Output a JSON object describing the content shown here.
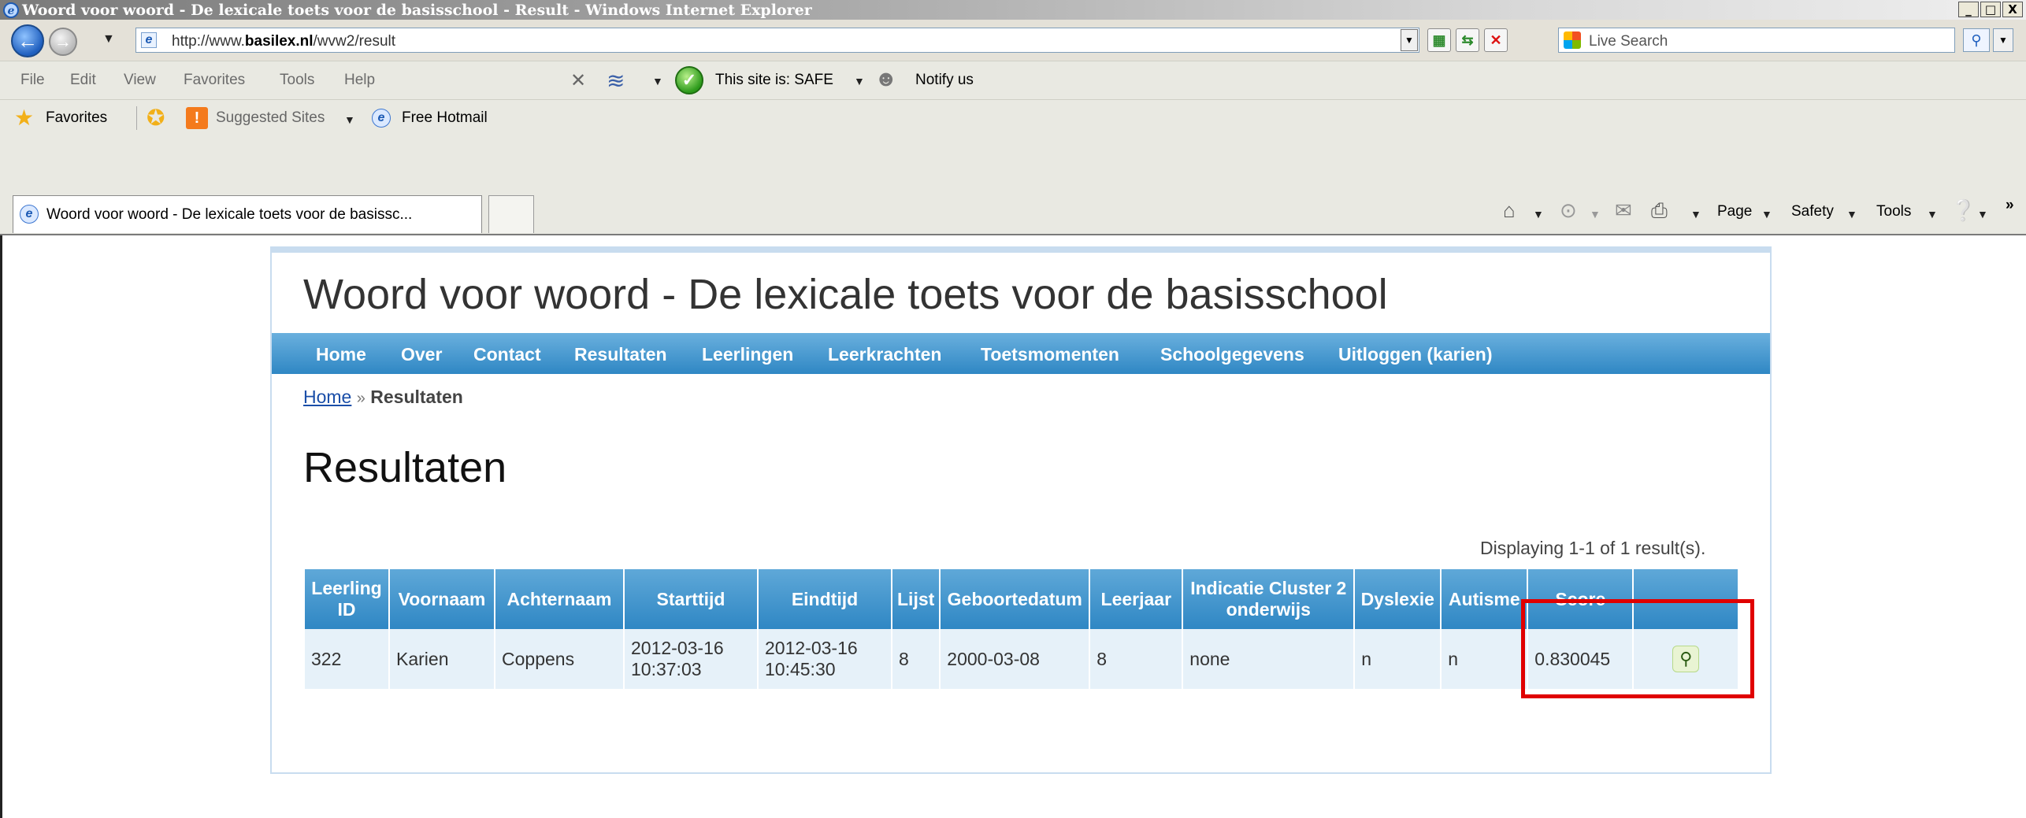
{
  "browser": {
    "window_title": "Woord voor woord - De lexicale toets voor de basisschool - Result - Windows Internet Explorer",
    "url_prefix": "http://www.",
    "url_domain": "basilex.nl",
    "url_path": "/wvw2/result",
    "search_placeholder": "Live Search",
    "menu": [
      "File",
      "Edit",
      "View",
      "Favorites",
      "Tools",
      "Help"
    ],
    "toolbar": {
      "safe_text": "This site is: SAFE",
      "notify_text": "Notify us"
    },
    "favorites_bar": {
      "favorites_label": "Favorites",
      "suggested_sites": "Suggested Sites",
      "hotmail": "Free Hotmail"
    },
    "tab_title": "Woord voor woord - De lexicale toets voor de basissc...",
    "command_bar": {
      "page": "Page",
      "safety": "Safety",
      "tools": "Tools"
    },
    "window_buttons": {
      "minimize": "_",
      "maximize": "□",
      "close": "X"
    }
  },
  "site": {
    "title": "Woord voor woord - De lexicale toets voor de basisschool",
    "nav": [
      "Home",
      "Over",
      "Contact",
      "Resultaten",
      "Leerlingen",
      "Leerkrachten",
      "Toetsmomenten",
      "Schoolgegevens",
      "Uitloggen (karien)"
    ],
    "breadcrumb": {
      "home": "Home",
      "separator": "»",
      "current": "Resultaten"
    },
    "heading": "Resultaten",
    "summary": "Displaying 1-1 of 1 result(s).",
    "table": {
      "headers": [
        "Leerling ID",
        "Voornaam",
        "Achternaam",
        "Starttijd",
        "Eindtijd",
        "Lijst",
        "Geboortedatum",
        "Leerjaar",
        "Indicatie Cluster 2 onderwijs",
        "Dyslexie",
        "Autisme",
        "Score",
        ""
      ],
      "rows": [
        [
          "322",
          "Karien",
          "Coppens",
          "2012-03-16 10:37:03",
          "2012-03-16 10:45:30",
          "8",
          "2000-03-08",
          "8",
          "none",
          "n",
          "n",
          "0.830045",
          ""
        ]
      ]
    }
  },
  "colors": {
    "menu_bar": "#2f87c4",
    "highlight_box": "#e00000"
  }
}
